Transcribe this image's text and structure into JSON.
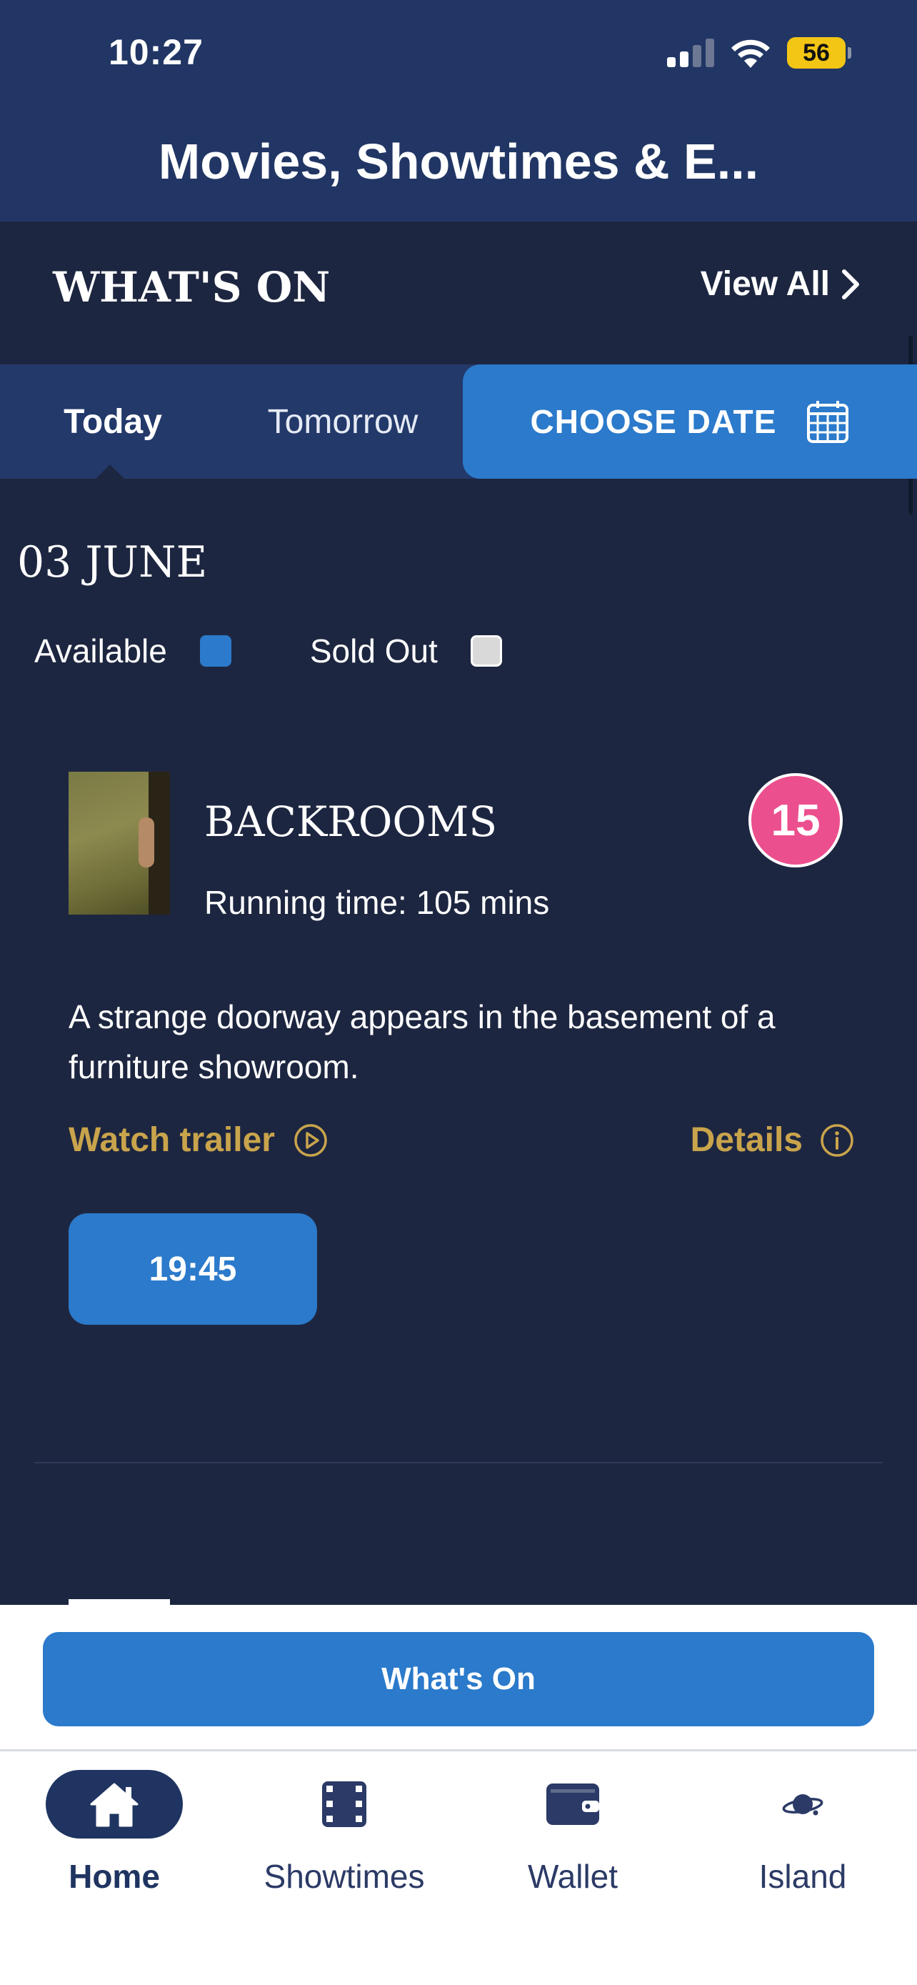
{
  "status_bar": {
    "time": "10:27",
    "battery": "56"
  },
  "app_bar": {
    "title": "Movies, Showtimes & E..."
  },
  "section": {
    "title": "WHAT'S ON",
    "view_all_label": "View All"
  },
  "date_tabs": {
    "today": "Today",
    "tomorrow": "Tomorrow",
    "choose_date": "CHOOSE DATE"
  },
  "date_heading": "03 JUNE",
  "legend": {
    "available": "Available",
    "sold_out": "Sold Out",
    "available_color": "#2b7acb",
    "sold_out_color": "#d9d9d9"
  },
  "movie": {
    "title": "BACKROOMS",
    "running_time": "Running time: 105 mins",
    "rating": "15",
    "synopsis": "A strange doorway appears in the basement of a furniture showroom.",
    "watch_trailer_label": "Watch trailer",
    "details_label": "Details",
    "showtimes": [
      "19:45"
    ]
  },
  "bottom_button": {
    "label": "What's On"
  },
  "nav": {
    "home": "Home",
    "showtimes": "Showtimes",
    "wallet": "Wallet",
    "island": "Island"
  },
  "colors": {
    "header": "#213664",
    "background": "#1d2640",
    "accent_blue": "#2b7acb",
    "gold": "#c9a44c",
    "rating_pink": "#ec4f8e"
  }
}
